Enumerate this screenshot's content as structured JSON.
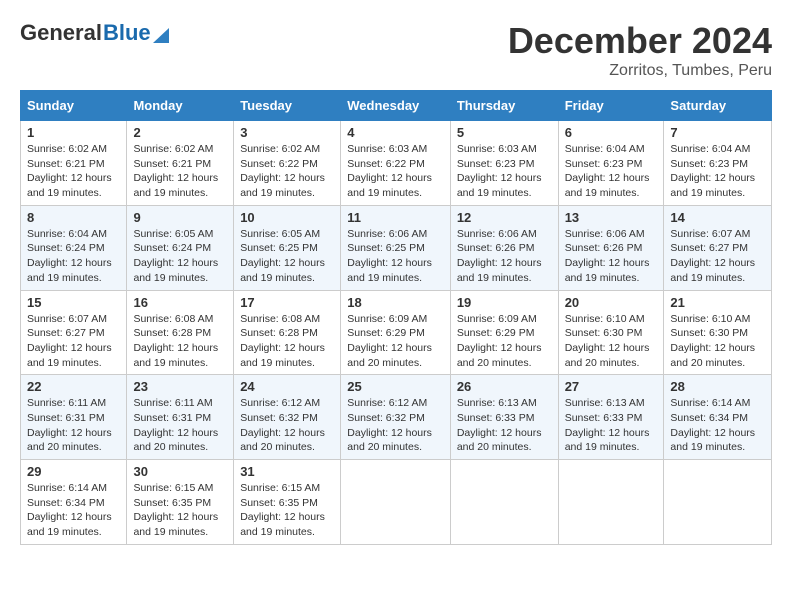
{
  "header": {
    "logo_general": "General",
    "logo_blue": "Blue",
    "month_title": "December 2024",
    "location": "Zorritos, Tumbes, Peru"
  },
  "weekdays": [
    "Sunday",
    "Monday",
    "Tuesday",
    "Wednesday",
    "Thursday",
    "Friday",
    "Saturday"
  ],
  "weeks": [
    [
      {
        "day": "1",
        "sunrise": "6:02 AM",
        "sunset": "6:21 PM",
        "daylight": "12 hours and 19 minutes."
      },
      {
        "day": "2",
        "sunrise": "6:02 AM",
        "sunset": "6:21 PM",
        "daylight": "12 hours and 19 minutes."
      },
      {
        "day": "3",
        "sunrise": "6:02 AM",
        "sunset": "6:22 PM",
        "daylight": "12 hours and 19 minutes."
      },
      {
        "day": "4",
        "sunrise": "6:03 AM",
        "sunset": "6:22 PM",
        "daylight": "12 hours and 19 minutes."
      },
      {
        "day": "5",
        "sunrise": "6:03 AM",
        "sunset": "6:23 PM",
        "daylight": "12 hours and 19 minutes."
      },
      {
        "day": "6",
        "sunrise": "6:04 AM",
        "sunset": "6:23 PM",
        "daylight": "12 hours and 19 minutes."
      },
      {
        "day": "7",
        "sunrise": "6:04 AM",
        "sunset": "6:23 PM",
        "daylight": "12 hours and 19 minutes."
      }
    ],
    [
      {
        "day": "8",
        "sunrise": "6:04 AM",
        "sunset": "6:24 PM",
        "daylight": "12 hours and 19 minutes."
      },
      {
        "day": "9",
        "sunrise": "6:05 AM",
        "sunset": "6:24 PM",
        "daylight": "12 hours and 19 minutes."
      },
      {
        "day": "10",
        "sunrise": "6:05 AM",
        "sunset": "6:25 PM",
        "daylight": "12 hours and 19 minutes."
      },
      {
        "day": "11",
        "sunrise": "6:06 AM",
        "sunset": "6:25 PM",
        "daylight": "12 hours and 19 minutes."
      },
      {
        "day": "12",
        "sunrise": "6:06 AM",
        "sunset": "6:26 PM",
        "daylight": "12 hours and 19 minutes."
      },
      {
        "day": "13",
        "sunrise": "6:06 AM",
        "sunset": "6:26 PM",
        "daylight": "12 hours and 19 minutes."
      },
      {
        "day": "14",
        "sunrise": "6:07 AM",
        "sunset": "6:27 PM",
        "daylight": "12 hours and 19 minutes."
      }
    ],
    [
      {
        "day": "15",
        "sunrise": "6:07 AM",
        "sunset": "6:27 PM",
        "daylight": "12 hours and 19 minutes."
      },
      {
        "day": "16",
        "sunrise": "6:08 AM",
        "sunset": "6:28 PM",
        "daylight": "12 hours and 19 minutes."
      },
      {
        "day": "17",
        "sunrise": "6:08 AM",
        "sunset": "6:28 PM",
        "daylight": "12 hours and 19 minutes."
      },
      {
        "day": "18",
        "sunrise": "6:09 AM",
        "sunset": "6:29 PM",
        "daylight": "12 hours and 20 minutes."
      },
      {
        "day": "19",
        "sunrise": "6:09 AM",
        "sunset": "6:29 PM",
        "daylight": "12 hours and 20 minutes."
      },
      {
        "day": "20",
        "sunrise": "6:10 AM",
        "sunset": "6:30 PM",
        "daylight": "12 hours and 20 minutes."
      },
      {
        "day": "21",
        "sunrise": "6:10 AM",
        "sunset": "6:30 PM",
        "daylight": "12 hours and 20 minutes."
      }
    ],
    [
      {
        "day": "22",
        "sunrise": "6:11 AM",
        "sunset": "6:31 PM",
        "daylight": "12 hours and 20 minutes."
      },
      {
        "day": "23",
        "sunrise": "6:11 AM",
        "sunset": "6:31 PM",
        "daylight": "12 hours and 20 minutes."
      },
      {
        "day": "24",
        "sunrise": "6:12 AM",
        "sunset": "6:32 PM",
        "daylight": "12 hours and 20 minutes."
      },
      {
        "day": "25",
        "sunrise": "6:12 AM",
        "sunset": "6:32 PM",
        "daylight": "12 hours and 20 minutes."
      },
      {
        "day": "26",
        "sunrise": "6:13 AM",
        "sunset": "6:33 PM",
        "daylight": "12 hours and 20 minutes."
      },
      {
        "day": "27",
        "sunrise": "6:13 AM",
        "sunset": "6:33 PM",
        "daylight": "12 hours and 19 minutes."
      },
      {
        "day": "28",
        "sunrise": "6:14 AM",
        "sunset": "6:34 PM",
        "daylight": "12 hours and 19 minutes."
      }
    ],
    [
      {
        "day": "29",
        "sunrise": "6:14 AM",
        "sunset": "6:34 PM",
        "daylight": "12 hours and 19 minutes."
      },
      {
        "day": "30",
        "sunrise": "6:15 AM",
        "sunset": "6:35 PM",
        "daylight": "12 hours and 19 minutes."
      },
      {
        "day": "31",
        "sunrise": "6:15 AM",
        "sunset": "6:35 PM",
        "daylight": "12 hours and 19 minutes."
      },
      null,
      null,
      null,
      null
    ]
  ]
}
